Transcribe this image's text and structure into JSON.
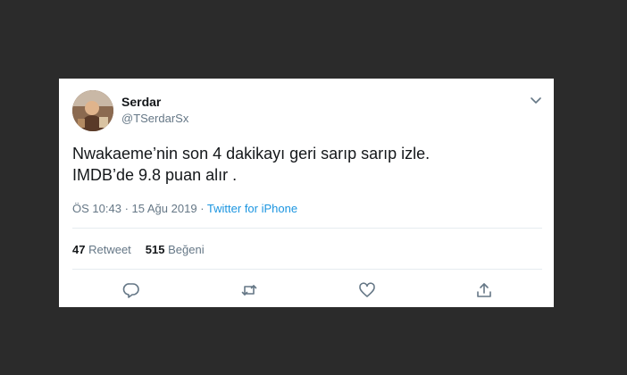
{
  "user": {
    "name": "Serdar",
    "handle": "@TSerdarSx"
  },
  "tweet": {
    "line1": "Nwakaeme’nin son 4 dakikayı geri sarıp sarıp izle.",
    "line2": "IMDB’de 9.8 puan alır ."
  },
  "meta": {
    "time": "ÖS 10:43",
    "separator": "·",
    "date": "15 Ağu 2019",
    "source": "Twitter for iPhone"
  },
  "stats": {
    "retweets_count": "47",
    "retweets_label": "Retweet",
    "likes_count": "515",
    "likes_label": "Beğeni"
  },
  "icons": {
    "menu": "chevron-down-icon",
    "reply": "reply-icon",
    "retweet": "retweet-icon",
    "like": "heart-icon",
    "share": "share-icon"
  },
  "colors": {
    "background": "#2b2b2b",
    "card": "#ffffff",
    "text": "#14171a",
    "secondary": "#657786",
    "link": "#1b95e0",
    "divider": "#e6ecf0"
  }
}
